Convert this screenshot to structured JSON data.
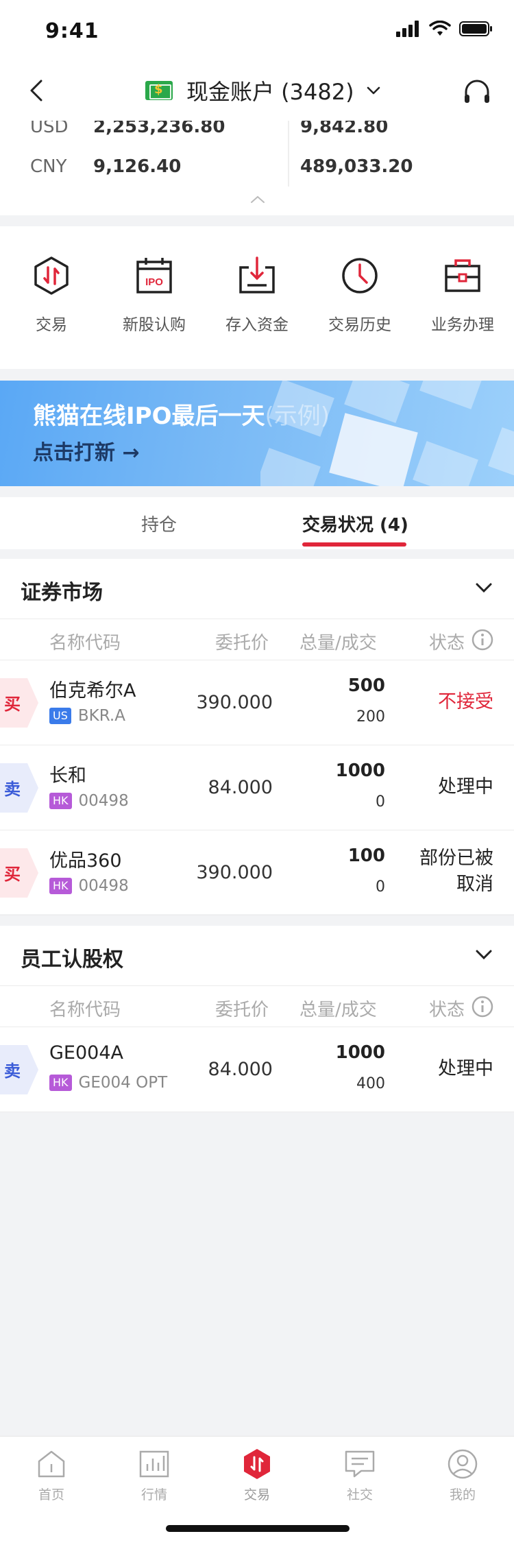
{
  "status_bar": {
    "time": "9:41"
  },
  "nav": {
    "title": "现金账户 (3482)"
  },
  "balances": [
    {
      "currency": "USD",
      "value1": "2,253,236.80",
      "value2": "9,842.80"
    },
    {
      "currency": "CNY",
      "value1": "9,126.40",
      "value2": "489,033.20"
    }
  ],
  "actions": [
    {
      "label": "交易",
      "icon": "trade-icon"
    },
    {
      "label": "新股认购",
      "icon": "ipo-calendar-icon"
    },
    {
      "label": "存入资金",
      "icon": "deposit-icon"
    },
    {
      "label": "交易历史",
      "icon": "clock-icon"
    },
    {
      "label": "业务办理",
      "icon": "briefcase-icon"
    }
  ],
  "banner": {
    "title": "熊猫在线IPO最后一天",
    "title_faint": "(示例)",
    "cta": "点击打新 →"
  },
  "tabs": [
    {
      "label": "持仓",
      "active": false
    },
    {
      "label": "交易状况 (4)",
      "active": true
    }
  ],
  "columns": {
    "name": "名称代码",
    "price": "委托价",
    "qty": "总量/成交",
    "status": "状态"
  },
  "sections": [
    {
      "title": "证券市场",
      "rows": [
        {
          "side": "买",
          "name": "伯克希尔A",
          "market": "US",
          "code": "BKR.A",
          "price": "390.000",
          "qty": "500",
          "filled": "200",
          "status": "不接受",
          "status_color": "#e0263a"
        },
        {
          "side": "卖",
          "name": "长和",
          "market": "HK",
          "code": "00498",
          "price": "84.000",
          "qty": "1000",
          "filled": "0",
          "status": "处理中",
          "status_color": "#222222"
        },
        {
          "side": "买",
          "name": "优品360",
          "market": "HK",
          "code": "00498",
          "price": "390.000",
          "qty": "100",
          "filled": "0",
          "status": "部份已被\n取消",
          "status_color": "#222222"
        }
      ]
    },
    {
      "title": "员工认股权",
      "rows": [
        {
          "side": "卖",
          "name": "GE004A",
          "market": "HK",
          "code": "GE004 OPT",
          "price": "84.000",
          "qty": "1000",
          "filled": "400",
          "status": "处理中",
          "status_color": "#222222"
        }
      ]
    }
  ],
  "tabbar": [
    {
      "label": "首页",
      "icon": "home-icon",
      "active": false
    },
    {
      "label": "行情",
      "icon": "market-chart-icon",
      "active": false
    },
    {
      "label": "交易",
      "icon": "trade-hex-icon",
      "active": true
    },
    {
      "label": "社交",
      "icon": "chat-icon",
      "active": false
    },
    {
      "label": "我的",
      "icon": "profile-icon",
      "active": false
    }
  ],
  "colors": {
    "accent_red": "#e0263a",
    "buy_bg": "#fde8ea",
    "sell_bg": "#e8ecfb",
    "sell_text": "#3a5bd8"
  }
}
